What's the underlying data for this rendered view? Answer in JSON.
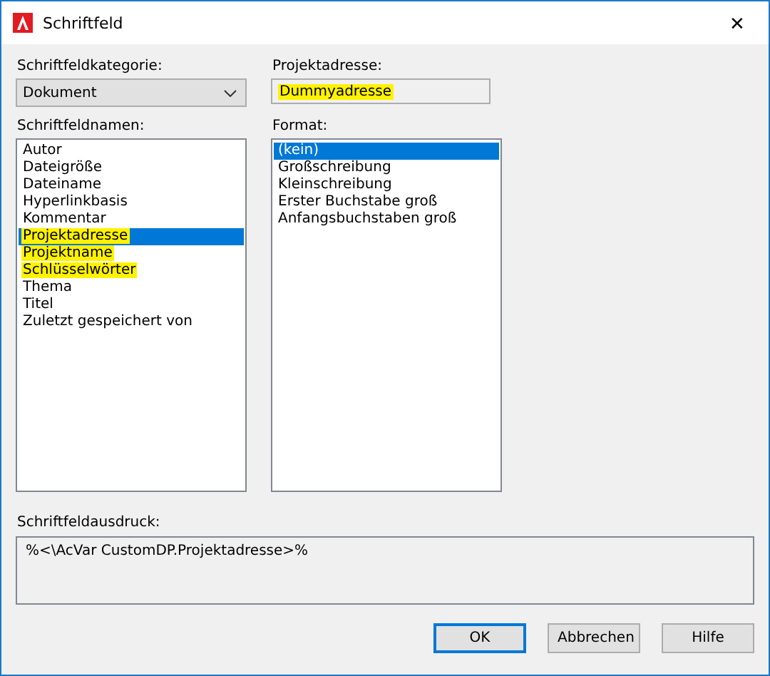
{
  "window": {
    "title": "Schriftfeld",
    "close": "✕"
  },
  "category": {
    "label": "Schriftfeldkategorie:",
    "value": "Dokument"
  },
  "names": {
    "label": "Schriftfeldnamen:",
    "items": [
      {
        "text": "Autor",
        "selected": false,
        "highlighted": false
      },
      {
        "text": "Dateigröße",
        "selected": false,
        "highlighted": false
      },
      {
        "text": "Dateiname",
        "selected": false,
        "highlighted": false
      },
      {
        "text": "Hyperlinkbasis",
        "selected": false,
        "highlighted": false
      },
      {
        "text": "Kommentar",
        "selected": false,
        "highlighted": false
      },
      {
        "text": "Projektadresse",
        "selected": true,
        "highlighted": true
      },
      {
        "text": "Projektname",
        "selected": false,
        "highlighted": true
      },
      {
        "text": "Schlüsselwörter",
        "selected": false,
        "highlighted": true
      },
      {
        "text": "Thema",
        "selected": false,
        "highlighted": false
      },
      {
        "text": "Titel",
        "selected": false,
        "highlighted": false
      },
      {
        "text": "Zuletzt gespeichert von",
        "selected": false,
        "highlighted": false
      }
    ]
  },
  "value": {
    "label": "Projektadresse:",
    "value": "Dummyadresse",
    "highlighted": true
  },
  "format": {
    "label": "Format:",
    "items": [
      {
        "text": "(kein)",
        "selected": true
      },
      {
        "text": "Großschreibung",
        "selected": false
      },
      {
        "text": "Kleinschreibung",
        "selected": false
      },
      {
        "text": "Erster Buchstabe groß",
        "selected": false
      },
      {
        "text": "Anfangsbuchstaben groß",
        "selected": false
      }
    ]
  },
  "expression": {
    "label": "Schriftfeldausdruck:",
    "value": "%<\\AcVar CustomDP.Projektadresse>%"
  },
  "buttons": [
    {
      "label": "OK",
      "default": true
    },
    {
      "label": "Abbrechen",
      "default": false
    },
    {
      "label": "Hilfe",
      "default": false
    }
  ]
}
